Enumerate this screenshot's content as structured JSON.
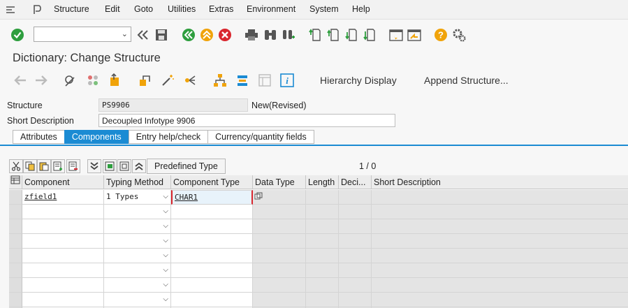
{
  "menu": {
    "items": [
      "Structure",
      "Edit",
      "Goto",
      "Utilities",
      "Extras",
      "Environment",
      "System",
      "Help"
    ]
  },
  "toolbar": {
    "command_field": "",
    "icons": [
      "enter-icon",
      "command-field",
      "collapse-icon",
      "save-icon",
      "back-icon",
      "exit-icon",
      "cancel-icon",
      "print-icon",
      "find-icon",
      "find-next-icon",
      "first-page-icon",
      "previous-page-icon",
      "next-page-icon",
      "last-page-icon",
      "create-session-icon",
      "shortcut-icon",
      "help-icon",
      "settings-icon"
    ]
  },
  "title": "Dictionary: Change Structure",
  "app_toolbar": {
    "hierarchy": "Hierarchy Display",
    "append": "Append Structure..."
  },
  "fields": {
    "structure_label": "Structure",
    "structure_value": "PS9906",
    "structure_status": "New(Revised)",
    "short_desc_label": "Short Description",
    "short_desc_value": "Decoupled Infotype 9906"
  },
  "tabs": [
    "Attributes",
    "Components",
    "Entry help/check",
    "Currency/quantity fields"
  ],
  "active_tab": "Components",
  "table_toolbar": {
    "predefined_type": "Predefined Type",
    "page": "1 / 0"
  },
  "grid": {
    "columns": [
      "Component",
      "Typing Method",
      "Component Type",
      "Data Type",
      "Length",
      "Deci...",
      "Short Description"
    ],
    "rows": [
      {
        "component": "zfield1",
        "typing": "1 Types",
        "comp_type": "CHAR1"
      }
    ],
    "empty_rows": 8
  },
  "colors": {
    "accent": "#1b8bd3",
    "ok_green": "#2e9e3e",
    "cancel_red": "#d9262e",
    "orange": "#f0a30a"
  }
}
